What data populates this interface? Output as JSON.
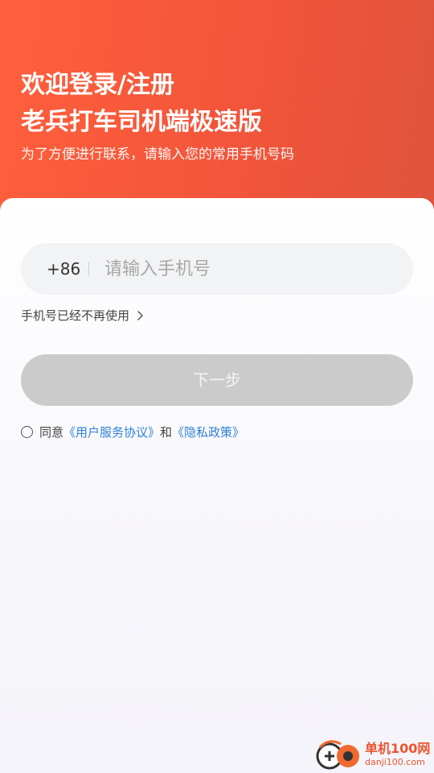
{
  "header": {
    "title_line1": "欢迎登录/注册",
    "title_line2": "老兵打车司机端极速版",
    "subtitle": "为了方便进行联系，请输入您的常用手机号码"
  },
  "phone": {
    "country_code": "+86",
    "placeholder": "请输入手机号"
  },
  "no_longer_used_link": "手机号已经不再使用",
  "next_button": "下一步",
  "agreement": {
    "prefix": "同意",
    "user_agreement": "《用户服务协议》",
    "connector": "和",
    "privacy_policy": "《隐私政策》"
  },
  "watermark": {
    "cn": "单机100网",
    "en": "danji100.com"
  },
  "colors": {
    "header_start": "#ff5f3c",
    "header_end": "#e0533c",
    "link": "#2f80d6",
    "button_disabled": "#cbcbcb"
  }
}
